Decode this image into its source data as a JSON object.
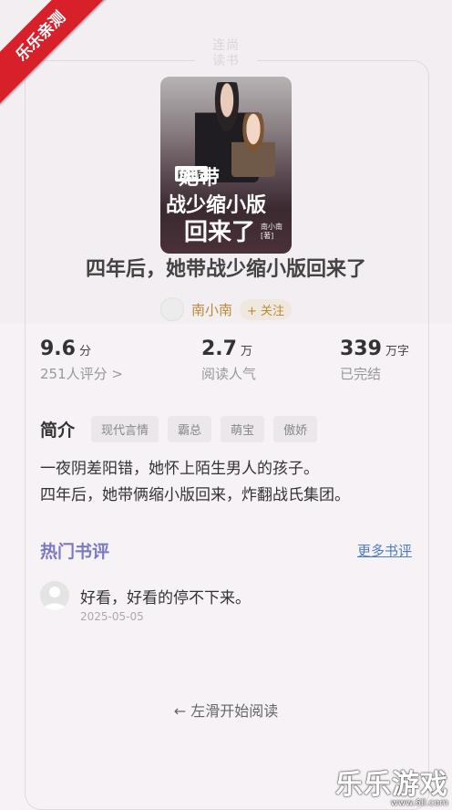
{
  "corner_badge": "乐乐亲测",
  "seal": [
    "连尚",
    "读书"
  ],
  "cover": {
    "tag": "四年后",
    "title_line1": "她带",
    "title_line2": "战少缩小版",
    "title_line3": "回来了",
    "pen_name": "南小南",
    "pen_suffix": "[著]"
  },
  "book_title": "四年后，她带战少缩小版回来了",
  "author": {
    "name": "南小南",
    "follow_label": "+ 关注",
    "avatar_icon": "avatar-icon"
  },
  "stats": [
    {
      "value": "9.6",
      "unit": "分",
      "label": "251人评分 >"
    },
    {
      "value": "2.7",
      "unit": "万",
      "label": "阅读人气"
    },
    {
      "value": "339",
      "unit": "万字",
      "label": "已完结"
    }
  ],
  "intro": {
    "title": "简介",
    "tags": [
      "现代言情",
      "霸总",
      "萌宝",
      "傲娇"
    ],
    "lines": [
      "一夜阴差阳错，她怀上陌生男人的孩子。",
      "四年后，她带俩缩小版回来，炸翻战氏集团。"
    ]
  },
  "reviews": {
    "title": "热门书评",
    "more_label": "更多书评",
    "items": [
      {
        "text": "好看，好看的停不下来。",
        "date": "2025-05-05"
      }
    ]
  },
  "swipe_hint": "← 左滑开始阅读",
  "watermark": {
    "text": "乐乐游戏",
    "url": "www.6ll.com"
  }
}
